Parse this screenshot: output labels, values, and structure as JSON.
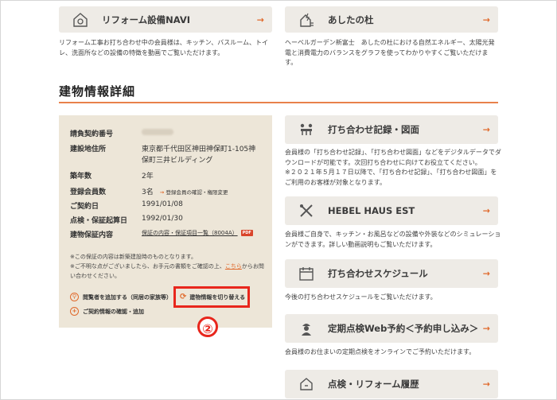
{
  "top_cards": [
    {
      "title": "リフォーム設備NAVI",
      "icon": "house-gear-icon",
      "desc": "リフォーム工事お打ち合わせ中の会員様は、キッチン、バスルーム、トイレ、洗面所などの設備の特徴を動画でご覧いただけます。"
    },
    {
      "title": "あしたの杜",
      "icon": "energy-house-icon",
      "desc": "ヘーベルガーデン新富士　あしたの杜における自然エネルギー、太陽光発電と消費電力のバランスをグラフを使ってわかりやすくご覧いただけます。"
    }
  ],
  "section_title": "建物情報詳細",
  "info": {
    "rows": [
      {
        "label": "請負契約番号",
        "value": ""
      },
      {
        "label": "建設地住所",
        "value": "東京都千代田区神田神保町1-105神",
        "value2": "保町三井ビルディング"
      },
      {
        "label": "築年数",
        "value": "2年"
      },
      {
        "label": "登録会員数",
        "value": "3名",
        "link": "登録会員の確認・権限変更"
      },
      {
        "label": "ご契約日",
        "value": "1991/01/08"
      },
      {
        "label": "点検・保証起算日",
        "value": "1992/01/30"
      },
      {
        "label": "建物保証内容",
        "value": "保証の内容・保証項目一覧（8004A）",
        "badge": "PDF"
      }
    ],
    "note_line1": "※この保証の内容は新築建設時のものとなります。",
    "note_line2": "※ご不明な点がございましたら、お手元の書類をご確認の上、",
    "note_link": "こちら",
    "note_line3": "からお問い合わせください。",
    "actions": {
      "add_viewer": "閲覧者を追加する（同居の家族等）",
      "switch": "建物情報を切り替える",
      "add_contract": "ご契約情報の確認・追加"
    },
    "step_marker": "②"
  },
  "right_cards": [
    {
      "title": "打ち合わせ記録・図面",
      "icon": "meeting-icon",
      "desc1": "会員様の「打ち合わせ記録」、「打ち合わせ図面」などをデジタルデータでダウンロードが可能です。次回打ち合わせに向けてお役立てください。",
      "desc2": "※２０２１年５月１７日以降で、「打ち合わせ記録」、「打ち合わせ図面」をご利用のお客様が対象となります。"
    },
    {
      "title": "HEBEL HAUS EST",
      "icon": "tools-icon",
      "desc1": "会員様ご自身で、キッチン・お風呂などの設備や外装などのシミュレーションができます。詳しい動画説明もご覧いただけます。"
    },
    {
      "title": "打ち合わせスケジュール",
      "icon": "calendar-icon",
      "desc1": "今後の打ち合わせスケジュールをご覧いただけます。"
    },
    {
      "title": "定期点検Web予約＜予約申し込み＞",
      "icon": "inspector-icon",
      "desc1": "会員様のお住まいの定期点検をオンラインでご予約いただけます。"
    },
    {
      "title": "点検・リフォーム履歴",
      "icon": "history-icon",
      "desc1": ""
    }
  ],
  "arrow": "→"
}
